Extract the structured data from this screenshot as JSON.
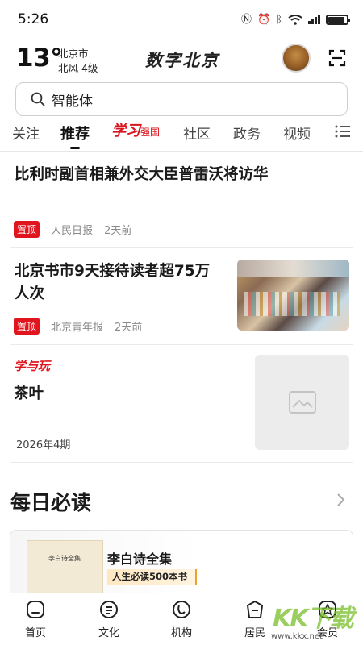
{
  "status_bar": {
    "time": "5:26"
  },
  "header": {
    "temperature": "13°",
    "city": "北京市",
    "wind": "北风 4级",
    "brand": "数字北京"
  },
  "search": {
    "value": "智能体"
  },
  "tabs": [
    {
      "label": "关注"
    },
    {
      "label": "推荐"
    },
    {
      "label": "强国"
    },
    {
      "label": "社区"
    },
    {
      "label": "政务"
    },
    {
      "label": "视频"
    }
  ],
  "xuexi_logo_text": "学习",
  "articles": [
    {
      "title": "比利时副首相兼外交大臣普雷沃将访华",
      "pin": "置顶",
      "source": "人民日报",
      "time": "2天前"
    },
    {
      "title_line1": "北京书市9天接待读者超75万",
      "title_line2": "人次",
      "pin": "置顶",
      "source": "北京青年报",
      "time": "2天前"
    }
  ],
  "feature": {
    "tag": "学与玩",
    "title": "茶叶",
    "issue": "2026年4期"
  },
  "daily": {
    "title": "每日必读",
    "card": {
      "title": "李白诗全集",
      "tag": "人生必读500本书",
      "book_title": "李白诗全集"
    }
  },
  "bottom_nav": [
    {
      "label": "首页",
      "icon": "home-icon"
    },
    {
      "label": "文化",
      "icon": "culture-icon"
    },
    {
      "label": "机构",
      "icon": "institution-icon"
    },
    {
      "label": "居民",
      "icon": "resident-icon"
    },
    {
      "label": "会员",
      "icon": "member-icon"
    }
  ],
  "watermark": {
    "text": "KK下载",
    "url": "www.kkx.net"
  }
}
